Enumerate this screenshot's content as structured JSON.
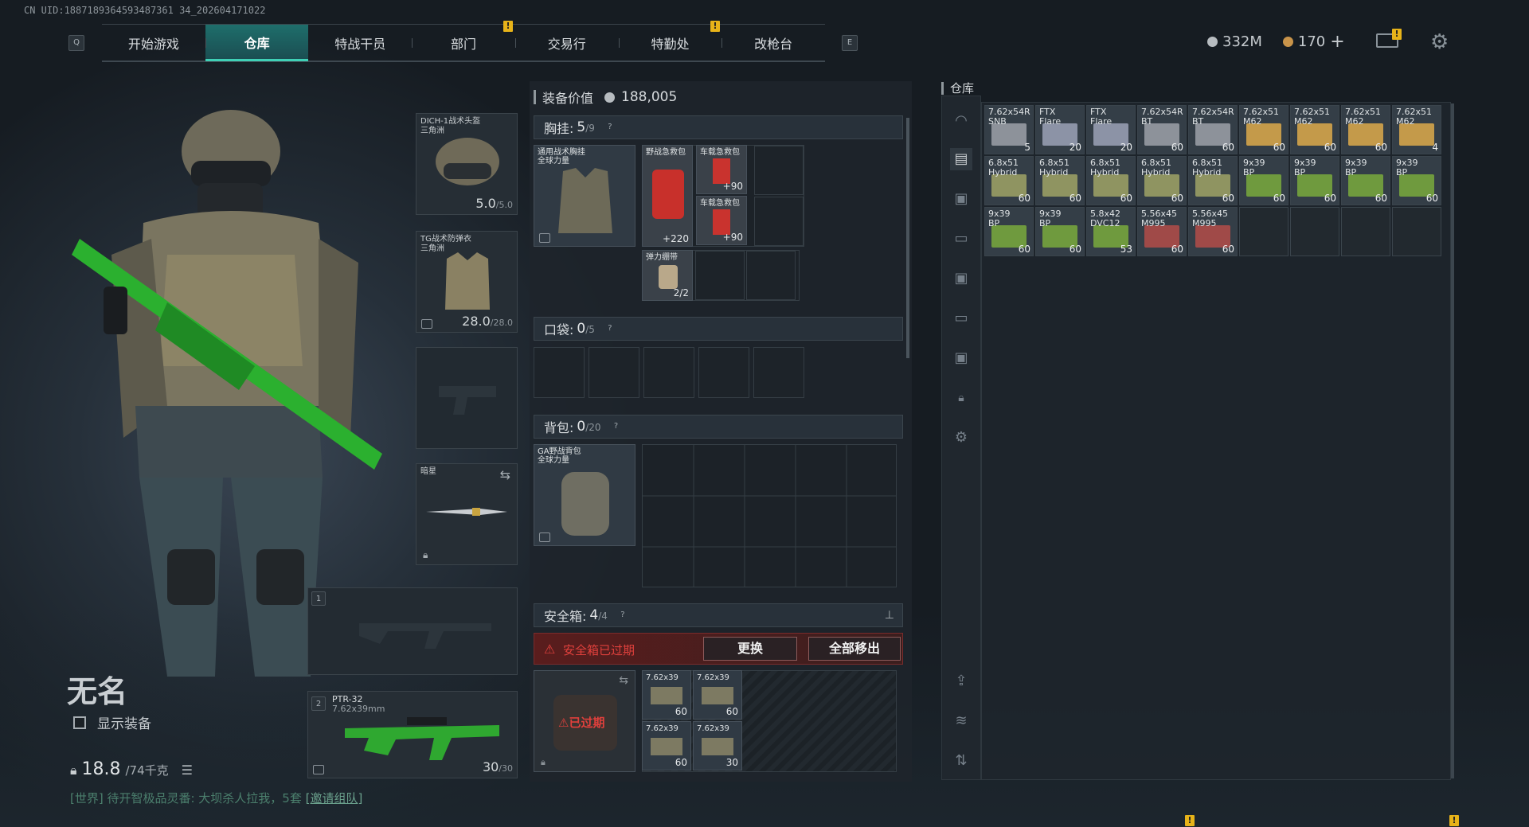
{
  "uid": "CN UID:1887189364593487361 34_202604171022",
  "nav": {
    "left_key": "Q",
    "right_key": "E",
    "tabs": [
      "开始游戏",
      "仓库",
      "特战干员",
      "部门",
      "交易行",
      "特勤处",
      "改枪台"
    ],
    "active_tab": "仓库"
  },
  "currency": {
    "silver": "332M",
    "gold": "170",
    "add": "+"
  },
  "alerts": {
    "mark": "!"
  },
  "character": {
    "name": "无名",
    "show_equipment": "显示装备",
    "weight": "18.8",
    "weight_max": "/74千克",
    "chat": "[世界] 待开智极品灵番: 大坝杀人拉我，5套",
    "chat_link": "[邀请组队]"
  },
  "equipment": {
    "helmet": {
      "name": "DICH-1战术头盔",
      "sub": "三角洲",
      "durability": "5.0",
      "max": "/5.0"
    },
    "armor": {
      "name": "TG战术防弹衣",
      "sub": "三角洲",
      "durability": "28.0",
      "max": "/28.0"
    },
    "melee": {
      "name": "暗星"
    },
    "slot1": "1",
    "slot2": "2",
    "primary": {
      "name": "PTR-32",
      "caliber": "7.62x39mm",
      "ammo": "30",
      "ammo_max": "/30"
    }
  },
  "loadout": {
    "value_label": "装备价值",
    "value": "188,005",
    "chest_rig": {
      "label": "胸挂:",
      "count": "5",
      "max": "/9",
      "help": "?",
      "item": "通用战术胸挂\n全球力量"
    },
    "chest_items": [
      {
        "name": "野战急救包",
        "count": "+220"
      },
      {
        "name": "车载急救包",
        "count": "+90"
      },
      {
        "name": "车载急救包",
        "count": "+90"
      },
      {
        "name": "弹力绷带",
        "count": "2/2"
      }
    ],
    "pockets": {
      "label": "口袋:",
      "count": "0",
      "max": "/5",
      "help": "?"
    },
    "backpack": {
      "label": "背包:",
      "count": "0",
      "max": "/20",
      "help": "?",
      "item": "GA野战背包\n全球力量"
    },
    "safebox": {
      "label": "安全箱:",
      "count": "4",
      "max": "/4",
      "help": "?",
      "expired_msg": "安全箱已过期",
      "replace": "更换",
      "remove_all": "全部移出",
      "expired_tag": "已过期",
      "items": [
        {
          "name": "7.62x39",
          "count": "60"
        },
        {
          "name": "7.62x39",
          "count": "60"
        },
        {
          "name": "7.62x39",
          "count": "60"
        },
        {
          "name": "7.62x39",
          "count": "30"
        }
      ]
    }
  },
  "stash": {
    "title": "仓库",
    "items": [
      {
        "name": "7.62x54R\nSNB",
        "count": "5",
        "color": "#8d929a"
      },
      {
        "name": "FTX\nFlare",
        "count": "20",
        "color": "#8c93a6"
      },
      {
        "name": "FTX\nFlare",
        "count": "20",
        "color": "#8c93a6"
      },
      {
        "name": "7.62x54R\nBT",
        "count": "60",
        "color": "#8d929a"
      },
      {
        "name": "7.62x54R\nBT",
        "count": "60",
        "color": "#8d929a"
      },
      {
        "name": "7.62x51\nM62",
        "count": "60",
        "color": "#c49a4a"
      },
      {
        "name": "7.62x51\nM62",
        "count": "60",
        "color": "#c49a4a"
      },
      {
        "name": "7.62x51\nM62",
        "count": "60",
        "color": "#c49a4a"
      },
      {
        "name": "7.62x51\nM62",
        "count": "4",
        "color": "#c49a4a"
      },
      {
        "name": "6.8x51\nHybrid",
        "count": "60",
        "color": "#8f9461"
      },
      {
        "name": "6.8x51\nHybrid",
        "count": "60",
        "color": "#8f9461"
      },
      {
        "name": "6.8x51\nHybrid",
        "count": "60",
        "color": "#8f9461"
      },
      {
        "name": "6.8x51\nHybrid",
        "count": "60",
        "color": "#8f9461"
      },
      {
        "name": "6.8x51\nHybrid",
        "count": "60",
        "color": "#8f9461"
      },
      {
        "name": "9x39\nBP",
        "count": "60",
        "color": "#6f9a3e"
      },
      {
        "name": "9x39\nBP",
        "count": "60",
        "color": "#6f9a3e"
      },
      {
        "name": "9x39\nBP",
        "count": "60",
        "color": "#6f9a3e"
      },
      {
        "name": "9x39\nBP",
        "count": "60",
        "color": "#6f9a3e"
      },
      {
        "name": "9x39\nBP",
        "count": "60",
        "color": "#6f9a3e"
      },
      {
        "name": "9x39\nBP",
        "count": "60",
        "color": "#6f9a3e"
      },
      {
        "name": "5.8x42\nDVC12",
        "count": "53",
        "color": "#6f9a3e"
      },
      {
        "name": "5.56x45\nM995",
        "count": "60",
        "color": "#a04a48"
      },
      {
        "name": "5.56x45\nM995",
        "count": "60",
        "color": "#a04a48"
      }
    ]
  },
  "side_icons": [
    "helmet-icon",
    "bag-icon",
    "crate-icon",
    "case-icon",
    "crate2-icon",
    "case2-icon",
    "crate3-icon",
    "lock-icon",
    "settings-icon",
    "export-icon",
    "layers-icon",
    "sort-icon"
  ]
}
